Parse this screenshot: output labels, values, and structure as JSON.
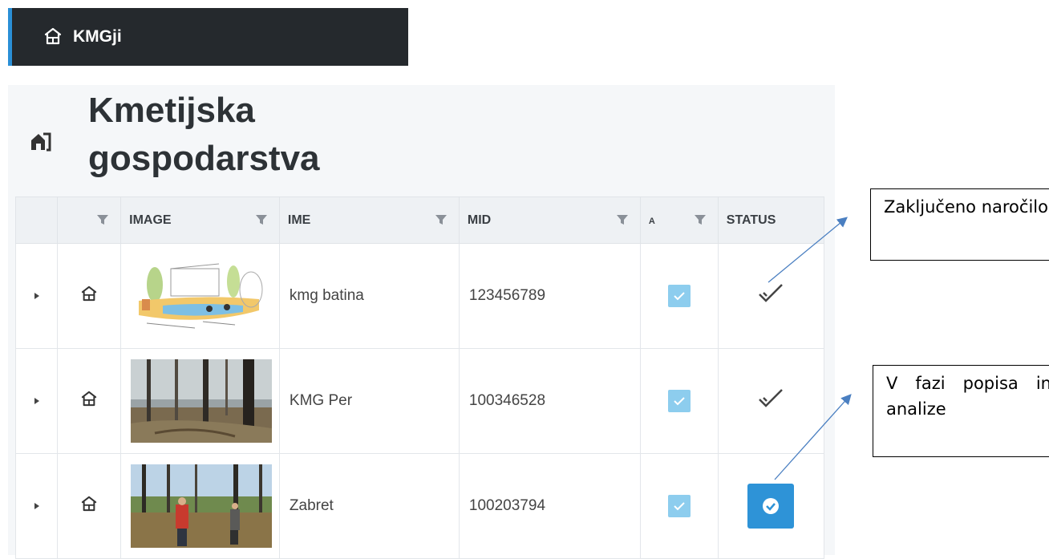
{
  "topbar": {
    "title": "KMGji",
    "icon": "home-icon"
  },
  "page": {
    "title": "Kmetijska gospodarstva",
    "icon": "farm-icon"
  },
  "table": {
    "columns": [
      "",
      "",
      "IMAGE",
      "IME",
      "MID",
      "A",
      "STATUS"
    ],
    "rows": [
      {
        "ime": "kmg batina",
        "mid": "123456789",
        "image": "garden-drawing",
        "checked": true,
        "status": "double-check"
      },
      {
        "ime": "KMG Per",
        "mid": "100346528",
        "image": "forest-photo",
        "checked": true,
        "status": "double-check"
      },
      {
        "ime": "Zabret",
        "mid": "100203794",
        "image": "forest-people-photo",
        "checked": true,
        "status": "check-button"
      }
    ]
  },
  "annotations": {
    "first": "Zaključeno naročilo",
    "second": "V fazi popisa in analize"
  },
  "colors": {
    "accent": "#2e93d7",
    "topbar": "#25292d",
    "checkbox": "#8dcdee"
  }
}
